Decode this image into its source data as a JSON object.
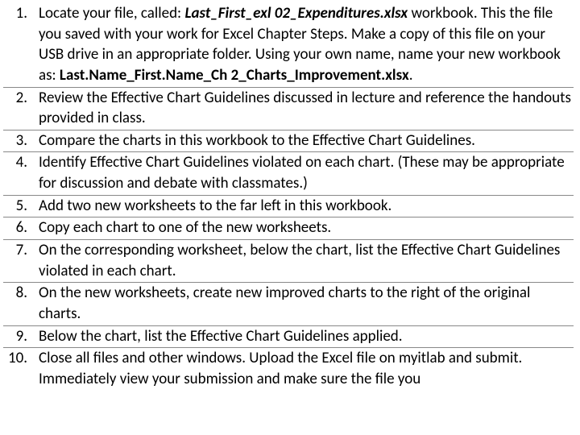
{
  "items": [
    {
      "parts": [
        {
          "t": "Locate your file, called: "
        },
        {
          "t": "Last_First_exl 02_Expenditures.xlsx",
          "b": true,
          "i": true
        },
        {
          "t": " workbook. This the file you saved with your work for Excel Chapter Steps.  Make a copy of this file on your USB drive in an appropriate folder.  Using your own name, name your new workbook as: "
        },
        {
          "t": "Last.Name_First.Name_Ch 2_Charts_Improvement.xlsx",
          "b": true
        },
        {
          "t": "."
        }
      ]
    },
    {
      "parts": [
        {
          "t": "Review the Effective Chart Guidelines discussed in lecture and reference the handouts provided in class."
        }
      ]
    },
    {
      "parts": [
        {
          "t": "Compare the charts in this workbook to the Effective Chart Guidelines."
        }
      ]
    },
    {
      "parts": [
        {
          "t": "Identify Effective Chart Guidelines violated on each chart.  (These may be appropriate for discussion and debate with classmates.)"
        }
      ]
    },
    {
      "parts": [
        {
          "t": "Add two new worksheets to the far left in this workbook."
        }
      ]
    },
    {
      "parts": [
        {
          "t": "Copy each chart to one of the new worksheets."
        }
      ]
    },
    {
      "parts": [
        {
          "t": "On the corresponding worksheet, below the chart, list the Effective Chart Guidelines violated in each chart."
        }
      ]
    },
    {
      "parts": [
        {
          "t": "On the new worksheets, create new improved charts to the right of the original charts."
        }
      ]
    },
    {
      "parts": [
        {
          "t": "Below the chart, list the Effective Chart Guidelines applied."
        }
      ]
    },
    {
      "parts": [
        {
          "t": "Close all files and other windows.  Upload the Excel file on myitlab and submit.  Immediately view your submission and make sure the file you"
        }
      ]
    }
  ]
}
